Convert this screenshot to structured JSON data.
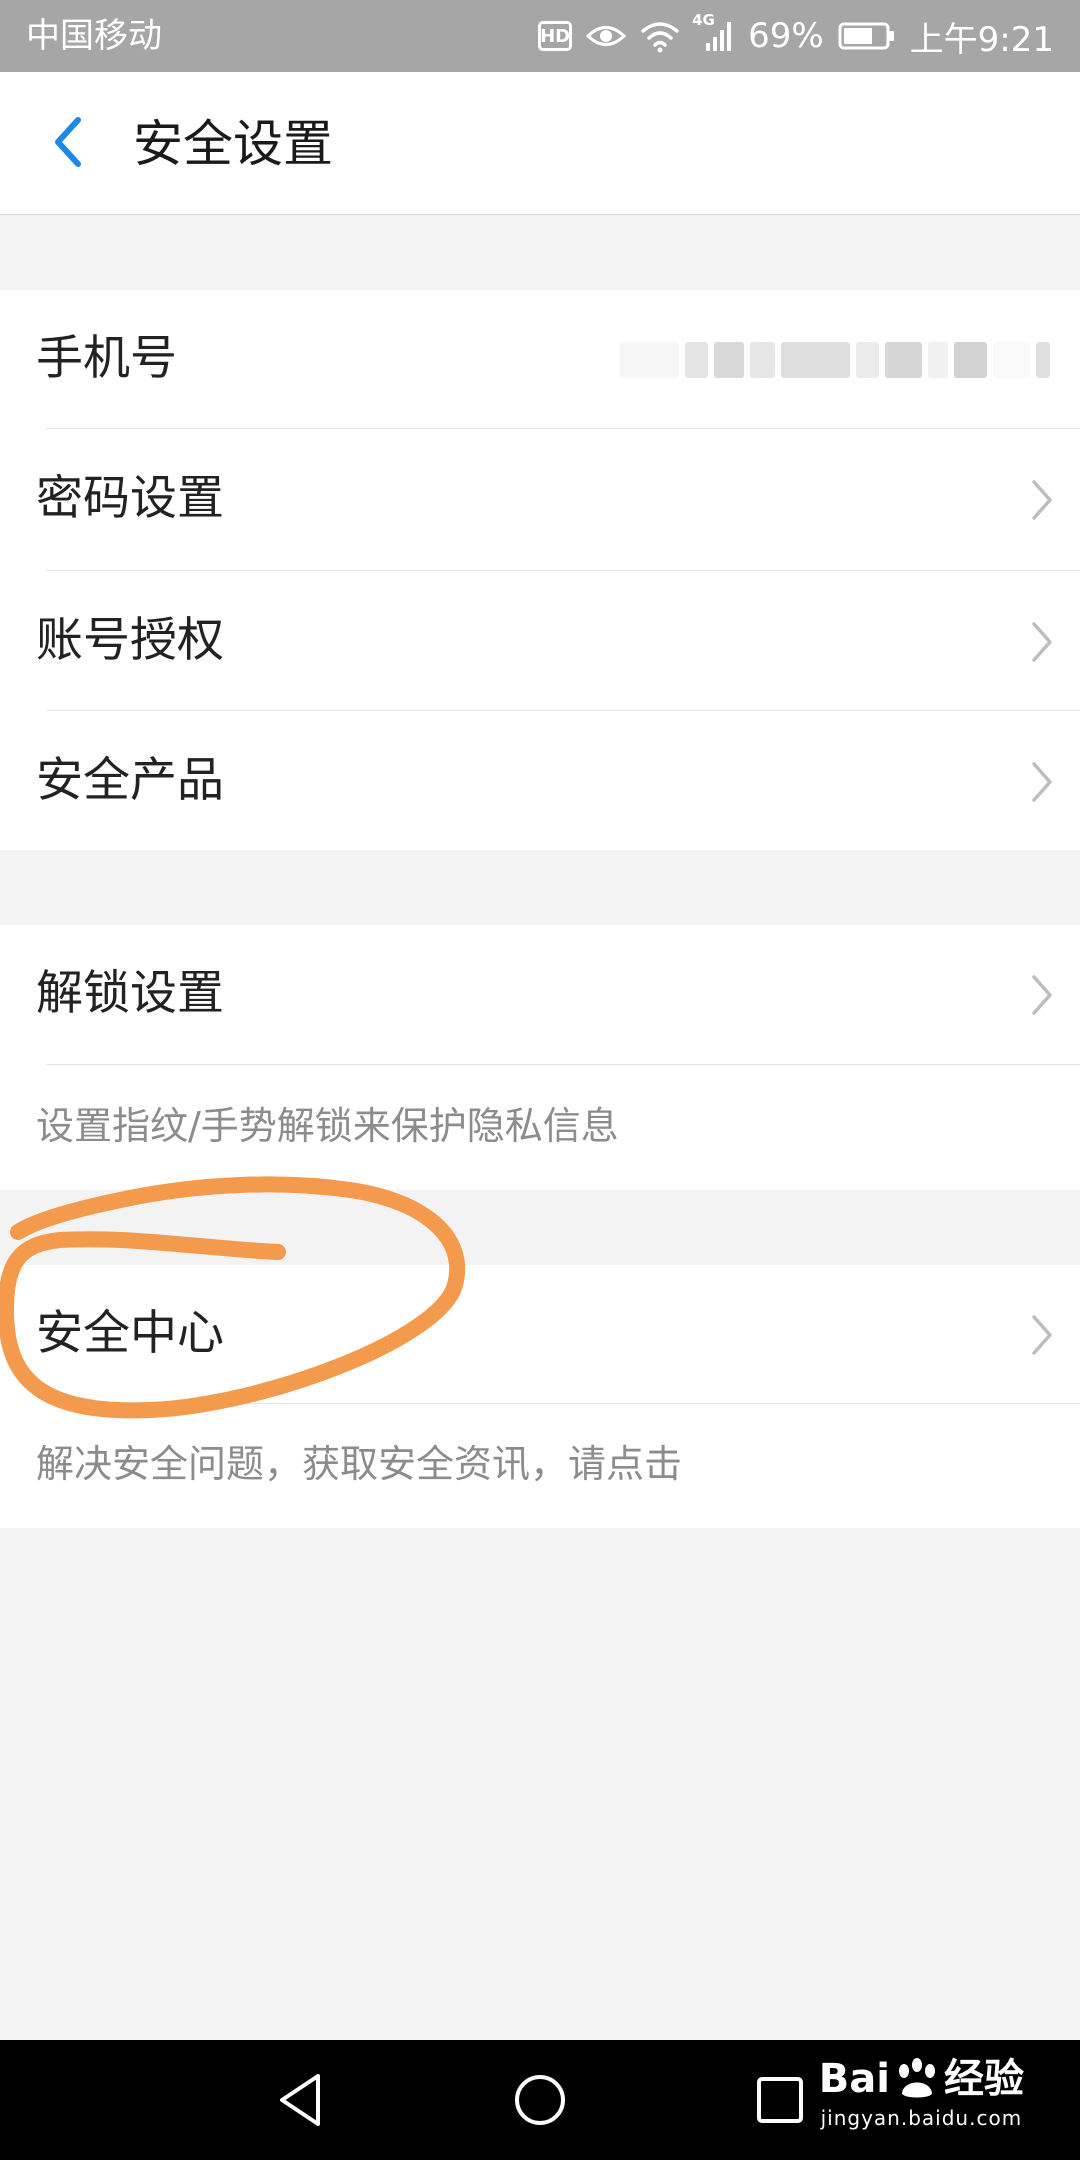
{
  "status_bar": {
    "carrier": "中国移动",
    "hd": "HD",
    "network": "4G",
    "battery": "69%",
    "time": "上午9:21"
  },
  "header": {
    "title": "安全设置",
    "back_icon": "chevron-left-icon"
  },
  "group_account": {
    "items": [
      {
        "label": "手机号",
        "value_masked": true
      },
      {
        "label": "密码设置"
      },
      {
        "label": "账号授权"
      },
      {
        "label": "安全产品"
      }
    ]
  },
  "group_unlock": {
    "label": "解锁设置",
    "hint": "设置指纹/手势解锁来保护隐私信息"
  },
  "group_security_center": {
    "label": "安全中心",
    "hint": "解决安全问题，获取安全资讯，请点击"
  },
  "nav_bar": {
    "back_icon": "triangle-back-icon",
    "home_icon": "circle-home-icon",
    "recents_icon": "square-recents-icon"
  },
  "watermark": {
    "brand_left": "Bai",
    "brand_right": "经验",
    "url": "jingyan.baidu.com"
  },
  "colors": {
    "accent": "#1e88e5",
    "annotation": "#f39a4c",
    "status_bar": "#a6a6a6",
    "background": "#f3f3f3"
  }
}
